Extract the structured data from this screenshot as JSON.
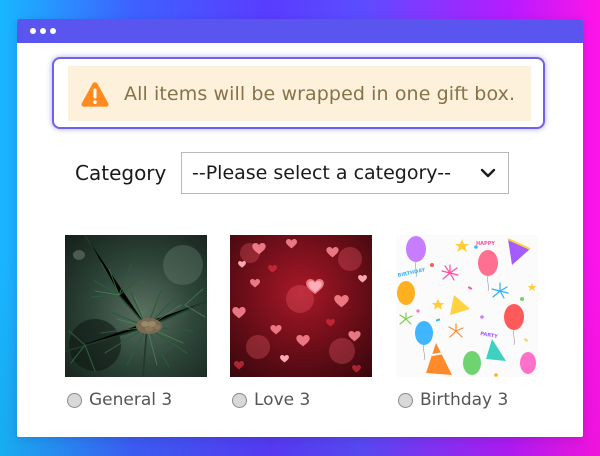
{
  "window": {
    "titlebar_dots": [
      "dot",
      "dot",
      "dot"
    ]
  },
  "notice": {
    "icon": "warning-icon",
    "text": "All items will be wrapped in one gift box."
  },
  "category": {
    "label": "Category",
    "selected": "--Please select a category--"
  },
  "wrap_options": [
    {
      "label": "General 3",
      "image": "pine-branch-photo"
    },
    {
      "label": "Love 3",
      "image": "red-hearts-photo"
    },
    {
      "label": "Birthday 3",
      "image": "birthday-pattern-photo"
    }
  ],
  "colors": {
    "titlebar": "#5b55f0",
    "notice_border": "#6f61ea",
    "notice_bg": "#fdf1db",
    "notice_text": "#87734a",
    "warning": "#ff8a1f"
  }
}
